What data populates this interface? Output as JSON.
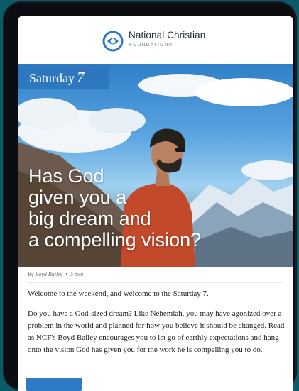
{
  "header": {
    "brand_name": "National Christian",
    "brand_sub": "FOUNDATION®",
    "accent": "#2e7ac4"
  },
  "hero": {
    "tag_label": "Saturday",
    "tag_number": "7",
    "headline_lines": [
      "Has God",
      "given you a",
      "big dream and",
      "a compelling vision?"
    ]
  },
  "article": {
    "author": "By Boyd Bailey",
    "separator": "•",
    "read_time": "5 min",
    "intro": "Welcome to the weekend, and welcome to the Saturday 7.",
    "body": "Do you have a God-sized dream? Like Nehemiah, you may have agonized over a problem in the world and planned for how you believe it should be changed. Read as NCF's Boyd Bailey encourages you to let go of earthly expectations and hang onto the vision God has given you for the work he is compelling you to do."
  }
}
